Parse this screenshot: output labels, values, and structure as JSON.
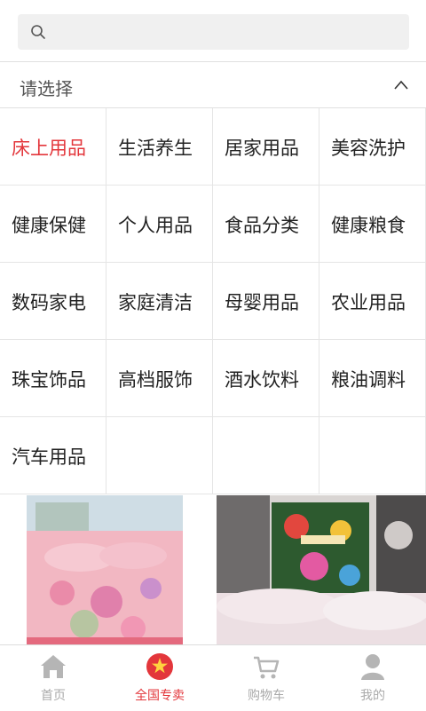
{
  "search": {
    "placeholder": ""
  },
  "select_header": {
    "label": "请选择"
  },
  "categories": [
    "床上用品",
    "生活养生",
    "居家用品",
    "美容洗护",
    "健康保健",
    "个人用品",
    "食品分类",
    "健康粮食",
    "数码家电",
    "家庭清洁",
    "母婴用品",
    "农业用品",
    "珠宝饰品",
    "高档服饰",
    "酒水饮料",
    "粮油调料",
    "汽车用品",
    "",
    "",
    ""
  ],
  "active_category": "床上用品",
  "bottom_nav": [
    {
      "label": "首页",
      "icon": "home-icon"
    },
    {
      "label": "全国专卖",
      "icon": "star-badge-icon"
    },
    {
      "label": "购物车",
      "icon": "cart-icon"
    },
    {
      "label": "我的",
      "icon": "user-icon"
    }
  ],
  "colors": {
    "accent": "#e3363b",
    "inactive": "#aaaaaa"
  }
}
